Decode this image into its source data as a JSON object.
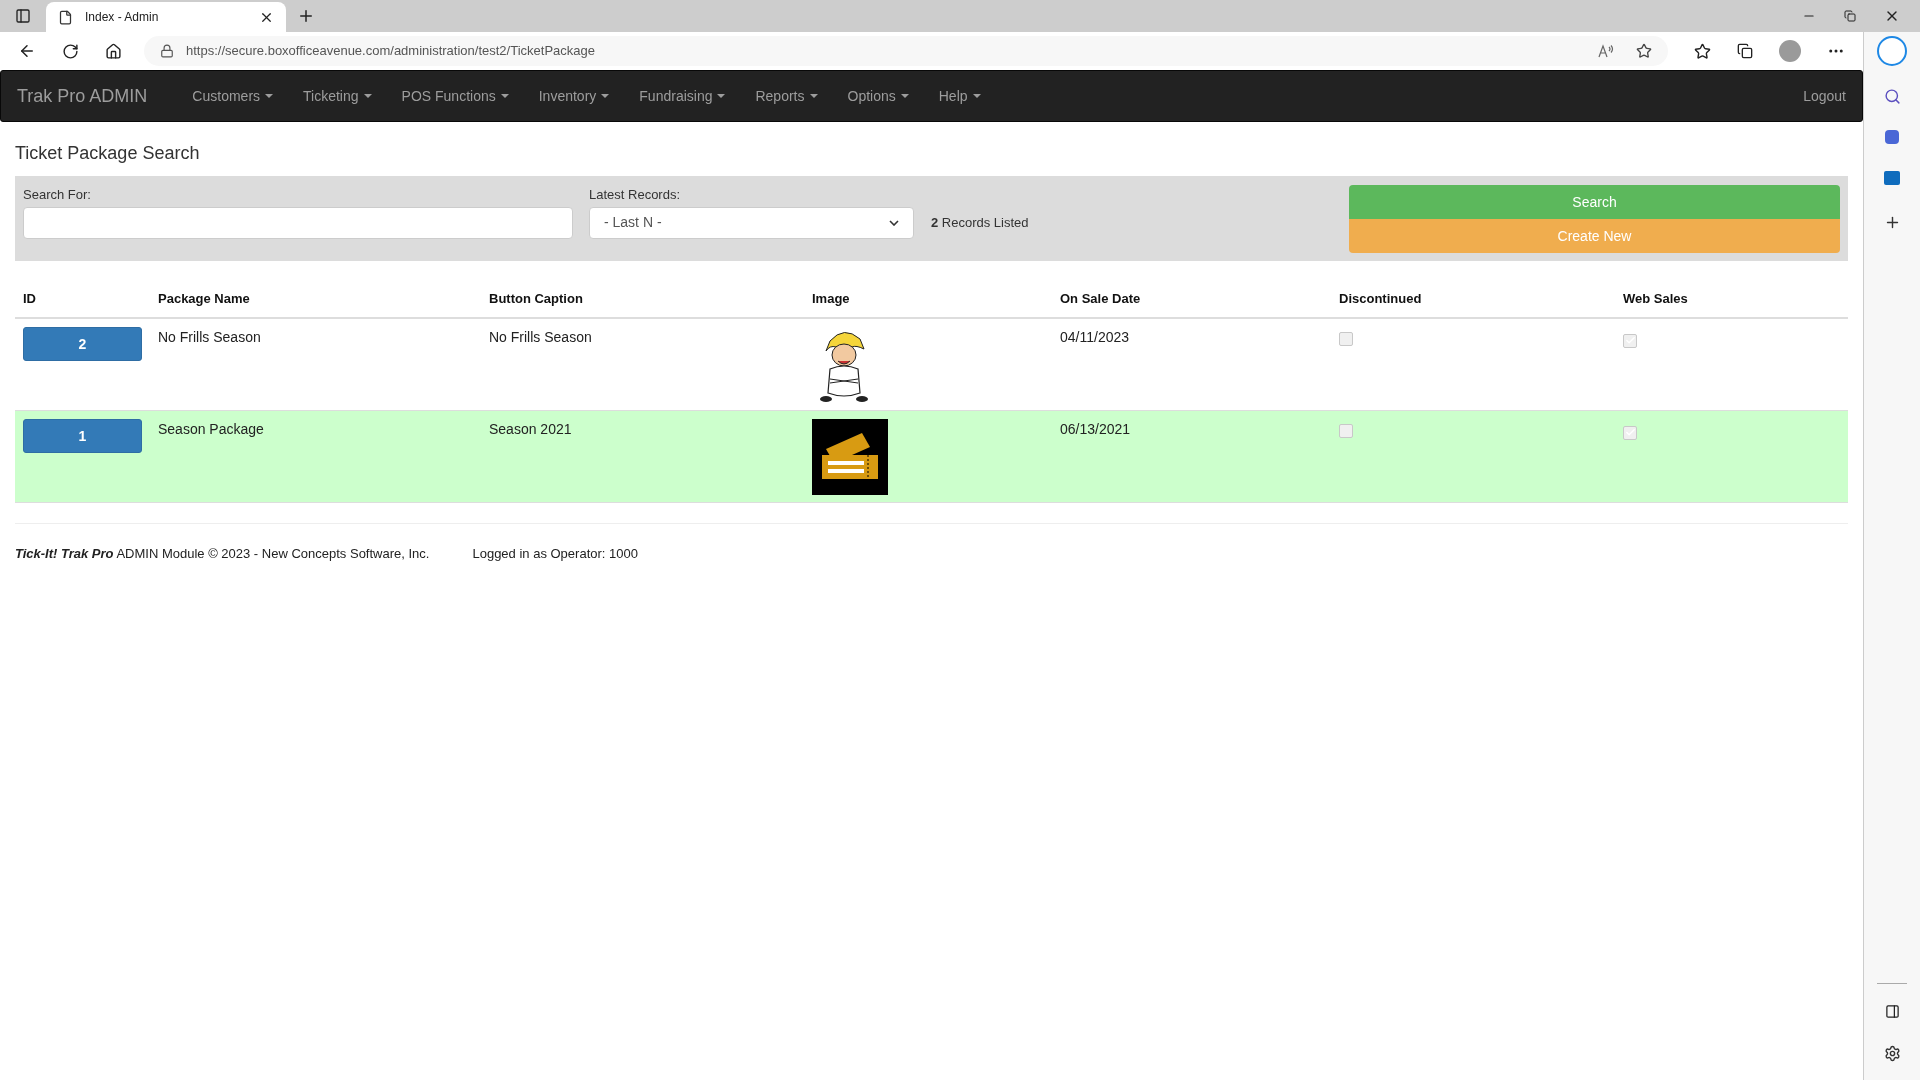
{
  "browser": {
    "tab_title": "Index - Admin",
    "url": "https://secure.boxofficeavenue.com/administration/test2/TicketPackage"
  },
  "navbar": {
    "brand": "Trak Pro ADMIN",
    "menus": [
      {
        "label": "Customers"
      },
      {
        "label": "Ticketing"
      },
      {
        "label": "POS Functions"
      },
      {
        "label": "Inventory"
      },
      {
        "label": "Fundraising"
      },
      {
        "label": "Reports"
      },
      {
        "label": "Options"
      },
      {
        "label": "Help"
      }
    ],
    "logout": "Logout"
  },
  "page_title": "Ticket Package Search",
  "search_panel": {
    "search_label": "Search For:",
    "latest_label": "Latest Records:",
    "latest_value": "- Last N -",
    "records": "**2** Records Listed",
    "search_button": "Search",
    "create_button": "Create New"
  },
  "table": {
    "columns": [
      "ID",
      "Package Name",
      "Button Caption",
      "Image",
      "On Sale Date",
      "Discontinued",
      "Web Sales"
    ],
    "rows": [
      {
        "id": "2",
        "package_name": "No Frills Season",
        "button_caption": "No Frills Season",
        "image": {
          "kind": "cartoon"
        },
        "on_sale_date": "04/11/2023",
        "discontinued": {
          "checked": false,
          "disabled": true
        },
        "web_sales": {
          "checked": true,
          "disabled": true
        },
        "highlighted": false
      },
      {
        "id": "1",
        "package_name": "Season Package",
        "button_caption": "Season 2021",
        "image": {
          "kind": "tickets"
        },
        "on_sale_date": "06/13/2021",
        "discontinued": {
          "checked": false,
          "disabled": true
        },
        "web_sales": {
          "checked": true,
          "disabled": true
        },
        "highlighted": true
      }
    ]
  },
  "footer": {
    "copyright": "**Tick-It! Trak Pro** ADMIN Module © 2023 - New Concepts Software, Inc.",
    "operator": "Logged in as Operator: 1000"
  }
}
